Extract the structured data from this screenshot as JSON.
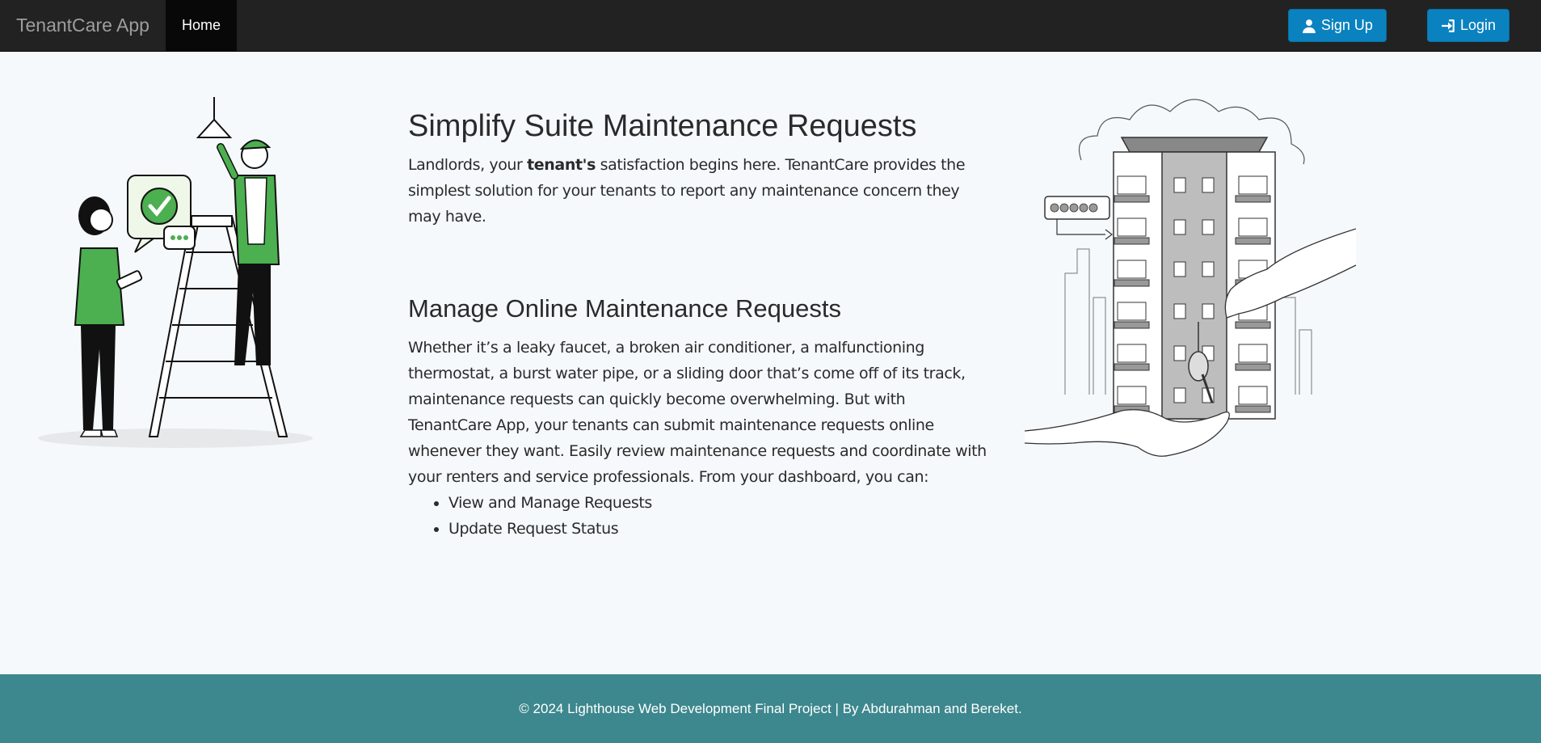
{
  "nav": {
    "brand": "TenantCare App",
    "home": "Home",
    "signup": "Sign Up",
    "login": "Login"
  },
  "section1": {
    "title": "Simplify Suite Maintenance Requests",
    "text_pre": "Landlords, your ",
    "text_bold": "tenant's",
    "text_post": " satisfaction begins here. TenantCare provides the simplest solution for your tenants to report any maintenance concern they may have."
  },
  "section2": {
    "title": "Manage Online Maintenance Requests",
    "text": "Whether it’s a leaky faucet, a broken air conditioner, a malfunctioning thermostat, a burst water pipe, or a sliding door that’s come off of its track, maintenance requests can quickly become overwhelming. But with TenantCare App, your tenants can submit maintenance requests online whenever they want. Easily review maintenance requests and coordinate with your renters and service professionals. From your dashboard, you can:",
    "items": [
      "View and Manage Requests",
      "Update Request Status"
    ]
  },
  "footer": {
    "text": "© 2024 Lighthouse Web Development Final Project | By Abdurahman and Bereket."
  },
  "colors": {
    "navbar": "#222222",
    "button": "#0a82bf",
    "accent_green": "#4caf50",
    "footer": "#3d878e",
    "background": "#f5f9fc"
  }
}
